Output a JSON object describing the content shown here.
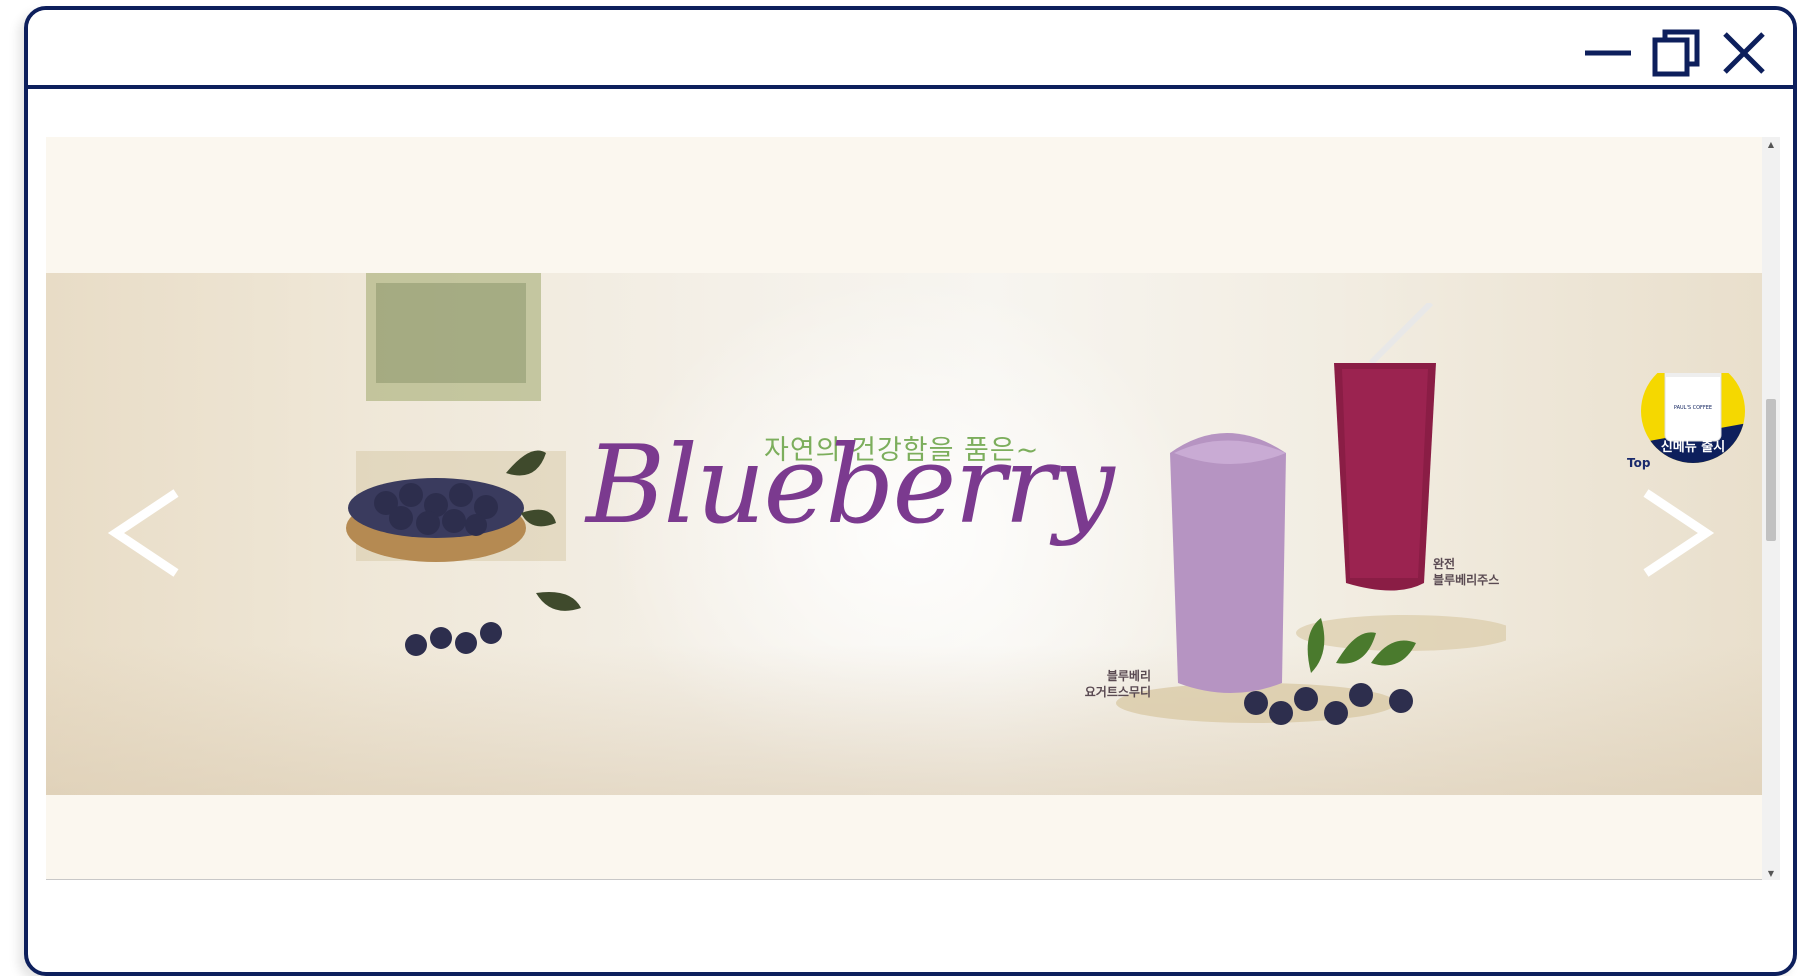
{
  "window": {
    "controls": {
      "minimize_icon": "minimize-icon",
      "maximize_icon": "restore-icon",
      "close_icon": "close-icon"
    }
  },
  "banner": {
    "tagline": "자연의 건강함을 품은~",
    "script_title": "Blueberry",
    "product_left": [
      "블루베리",
      "요거트스무디"
    ],
    "product_right": [
      "완전",
      "블루베리주스"
    ],
    "badge_text": "신메뉴 출시",
    "badge_brand": "PAUL'S COFFEE",
    "top_label": "Top",
    "prev_icon": "chevron-left-icon",
    "next_icon": "chevron-right-icon"
  },
  "colors": {
    "frame": "#0d1f5c",
    "script": "#7b3a8f",
    "tagline": "#7cae5c",
    "badge_yellow": "#f5d800",
    "badge_navy": "#0d1f5c"
  }
}
